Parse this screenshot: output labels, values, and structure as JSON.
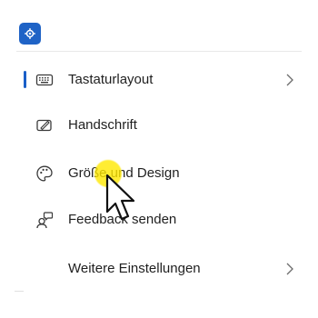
{
  "header": {
    "icon": "settings-gear-icon",
    "accent_color": "#1f63c6"
  },
  "menu": {
    "items": [
      {
        "label": "Tastaturlayout",
        "icon": "keyboard-icon",
        "selected": true,
        "has_chevron": true
      },
      {
        "label": "Handschrift",
        "icon": "pen-icon",
        "selected": false,
        "has_chevron": false
      },
      {
        "label": "Größe und Design",
        "icon": "palette-icon",
        "selected": false,
        "has_chevron": false
      },
      {
        "label": "Feedback senden",
        "icon": "feedback-person-icon",
        "selected": false,
        "has_chevron": false
      },
      {
        "label": "Weitere Einstellungen",
        "icon": "",
        "selected": false,
        "has_chevron": true
      }
    ]
  },
  "cursor": {
    "icon": "mouse-pointer-icon",
    "highlight_color": "#ffe800"
  }
}
